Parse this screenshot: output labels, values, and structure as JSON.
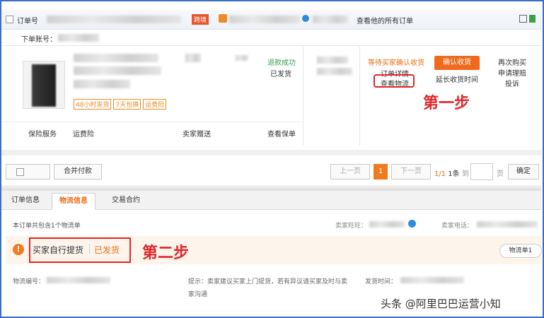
{
  "order": {
    "order_no_label": "订单号",
    "cross_border_tag": "跨境",
    "view_all_label": "查看他的所有订单",
    "account_label": "下单账号："
  },
  "product": {
    "badges": [
      "48小时发货",
      "7天包换",
      "运费险"
    ],
    "refund_status": "退款成功",
    "ship_status": "已发货"
  },
  "order_status": {
    "waiting_text": "等待买家确认收货",
    "detail_link": "订单详情",
    "logistics_link": "查看物流",
    "confirm_button": "确认收货",
    "extend_link": "延长收货时间",
    "rebuy_link": "再次购买",
    "claim_link": "申请理赔",
    "complaint_link": "投诉"
  },
  "services": {
    "insurance": "保险服务",
    "freight_insurance": "运费险",
    "seller_gift": "卖家赠送",
    "view_policy": "查看保单"
  },
  "annotations": {
    "step1": "第一步",
    "step2": "第二步"
  },
  "pagination": {
    "merge_pay": "合并付款",
    "prev": "上一页",
    "current": "1",
    "next": "下一页",
    "info_page": "1/1",
    "info_count": "1条",
    "goto_label": "到",
    "page_unit": "页",
    "confirm": "确定"
  },
  "tabs": [
    "订单信息",
    "物流信息",
    "交易合约"
  ],
  "logistics": {
    "count_text": "本订单共包含1个物流单",
    "seller_wangwang_label": "卖家旺旺：",
    "seller_phone_label": "卖家电话：",
    "method": "买家自行提货",
    "status": "已发货",
    "waybill_button": "物流单1",
    "waybill_no_label": "物流编号：",
    "hint_line1": "提示：卖家建议买家上门提货，若有异议请买家及时与卖",
    "hint_line2": "家沟通",
    "ship_time_label": "发货时间："
  },
  "watermark": "头条 @阿里巴巴运营小知",
  "colors": {
    "accent_orange": "#e96f14",
    "confirm_button": "#f06a1d",
    "callout_red": "#e3262a",
    "refund_green": "#3aa14a",
    "frame_blue": "#3a6fc8"
  }
}
